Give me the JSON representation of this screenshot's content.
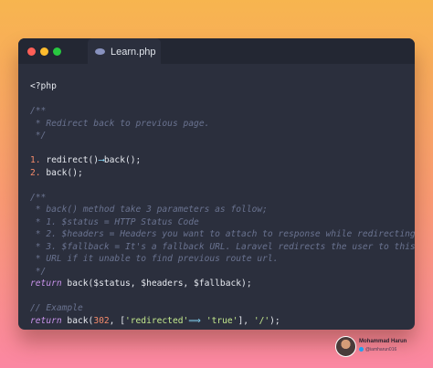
{
  "window": {
    "tab_label": "Learn.php",
    "tab_icon": "php-file-icon",
    "traffic_lights": {
      "close": "#ff5f57",
      "minimize": "#febc2e",
      "maximize": "#28c840"
    }
  },
  "colors": {
    "background": "#2b2f3d",
    "titlebar": "#232733",
    "comment": "#6a7390",
    "keyword": "#c792ea",
    "number": "#f78c6c",
    "string": "#c3e88d",
    "operator": "#89ddff",
    "plain": "#e6e9ef"
  },
  "code": {
    "lines": [
      [
        {
          "t": "<?php",
          "k": "plain"
        }
      ],
      [],
      [
        {
          "t": "/**",
          "k": "comment"
        }
      ],
      [
        {
          "t": " * Redirect back to previous page.",
          "k": "comment"
        }
      ],
      [
        {
          "t": " */",
          "k": "comment"
        }
      ],
      [],
      [
        {
          "t": "1. ",
          "k": "number"
        },
        {
          "t": "redirect()",
          "k": "plain"
        },
        {
          "t": "⟶",
          "k": "operator"
        },
        {
          "t": "back();",
          "k": "plain"
        }
      ],
      [
        {
          "t": "2. ",
          "k": "number"
        },
        {
          "t": "back();",
          "k": "plain"
        }
      ],
      [],
      [
        {
          "t": "/**",
          "k": "comment"
        }
      ],
      [
        {
          "t": " * back() method take 3 parameters as follow;",
          "k": "comment"
        }
      ],
      [
        {
          "t": " * 1. $status = HTTP Status Code",
          "k": "comment"
        }
      ],
      [
        {
          "t": " * 2. $headers = Headers you want to attach to response while redirecting.",
          "k": "comment"
        }
      ],
      [
        {
          "t": " * 3. $fallback = It's a fallback URL. Laravel redirects the user to this",
          "k": "comment"
        }
      ],
      [
        {
          "t": " * URL if it unable to find previous route url.",
          "k": "comment"
        }
      ],
      [
        {
          "t": " */",
          "k": "comment"
        }
      ],
      [
        {
          "t": "return",
          "k": "keyword"
        },
        {
          "t": " back($status, $headers, $fallback);",
          "k": "plain"
        }
      ],
      [],
      [
        {
          "t": "// Example",
          "k": "comment"
        }
      ],
      [
        {
          "t": "return",
          "k": "keyword"
        },
        {
          "t": " back(",
          "k": "plain"
        },
        {
          "t": "302",
          "k": "number"
        },
        {
          "t": ", [",
          "k": "plain"
        },
        {
          "t": "'redirected'",
          "k": "string"
        },
        {
          "t": "⟹",
          "k": "operator"
        },
        {
          "t": " ",
          "k": "plain"
        },
        {
          "t": "'true'",
          "k": "string"
        },
        {
          "t": "], ",
          "k": "plain"
        },
        {
          "t": "'/'",
          "k": "string"
        },
        {
          "t": ");",
          "k": "plain"
        }
      ]
    ]
  },
  "author": {
    "name": "Mohammad Harun",
    "handle": "@iamharun016",
    "avatar_icon": "avatar",
    "handle_icon": "twitter-icon",
    "handle_icon_color": "#1da1f2"
  }
}
